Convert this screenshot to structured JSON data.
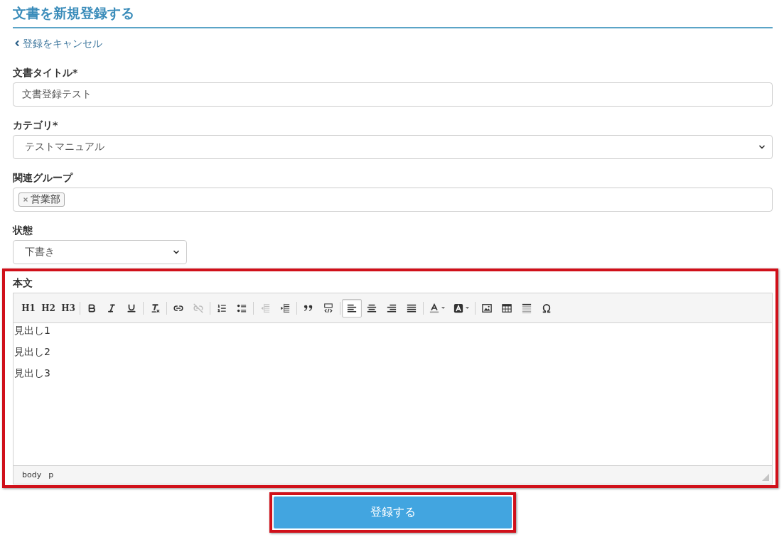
{
  "page": {
    "title": "文書を新規登録する",
    "cancel_link": "登録をキャンセル"
  },
  "fields": [
    {
      "kind": "text",
      "label": "文書タイトル*",
      "value": "文書登録テスト"
    },
    {
      "kind": "select",
      "label": "カテゴリ*",
      "value": "テストマニュアル",
      "wide": true
    },
    {
      "kind": "tags",
      "label": "関連グループ",
      "tags": [
        "営業部"
      ]
    },
    {
      "kind": "select",
      "label": "状態",
      "value": "下書き",
      "wide": false
    }
  ],
  "editor": {
    "label": "本文",
    "highlighted": true,
    "toolbar": [
      [
        {
          "kind": "text",
          "label": "H1",
          "selected": false,
          "disabled": false
        },
        {
          "kind": "text",
          "label": "H2",
          "selected": false,
          "disabled": false
        },
        {
          "kind": "text",
          "label": "H3",
          "selected": false,
          "disabled": false
        }
      ],
      [
        {
          "kind": "icon",
          "selected": false,
          "disabled": false
        },
        {
          "kind": "icon",
          "selected": false,
          "disabled": false
        },
        {
          "kind": "icon",
          "selected": false,
          "disabled": false
        }
      ],
      [
        {
          "kind": "icon",
          "selected": false,
          "disabled": false
        }
      ],
      [
        {
          "kind": "icon",
          "selected": false,
          "disabled": false
        },
        {
          "kind": "icon",
          "selected": false,
          "disabled": true
        }
      ],
      [
        {
          "kind": "icon",
          "selected": false,
          "disabled": false
        },
        {
          "kind": "icon",
          "selected": false,
          "disabled": false
        }
      ],
      [
        {
          "kind": "icon",
          "selected": false,
          "disabled": true
        },
        {
          "kind": "icon",
          "selected": false,
          "disabled": false
        }
      ],
      [
        {
          "kind": "icon",
          "selected": false,
          "disabled": false
        },
        {
          "kind": "icon",
          "selected": false,
          "disabled": false
        }
      ],
      [
        {
          "kind": "icon",
          "selected": true,
          "disabled": false
        },
        {
          "kind": "icon",
          "selected": false,
          "disabled": false
        },
        {
          "kind": "icon",
          "selected": false,
          "disabled": false
        },
        {
          "kind": "icon",
          "selected": false,
          "disabled": false
        }
      ],
      [
        {
          "kind": "menu",
          "selected": false,
          "disabled": false
        },
        {
          "kind": "menu",
          "selected": false,
          "disabled": false
        }
      ],
      [
        {
          "kind": "icon",
          "selected": false,
          "disabled": false
        },
        {
          "kind": "icon",
          "selected": false,
          "disabled": false
        },
        {
          "kind": "icon",
          "selected": false,
          "disabled": false
        },
        {
          "kind": "icon",
          "selected": false,
          "disabled": false
        }
      ]
    ],
    "content": [
      "見出し1",
      "見出し2",
      "見出し3"
    ],
    "path": [
      "body",
      "p"
    ]
  },
  "submit_button": {
    "label": "登録する",
    "highlighted": true
  }
}
